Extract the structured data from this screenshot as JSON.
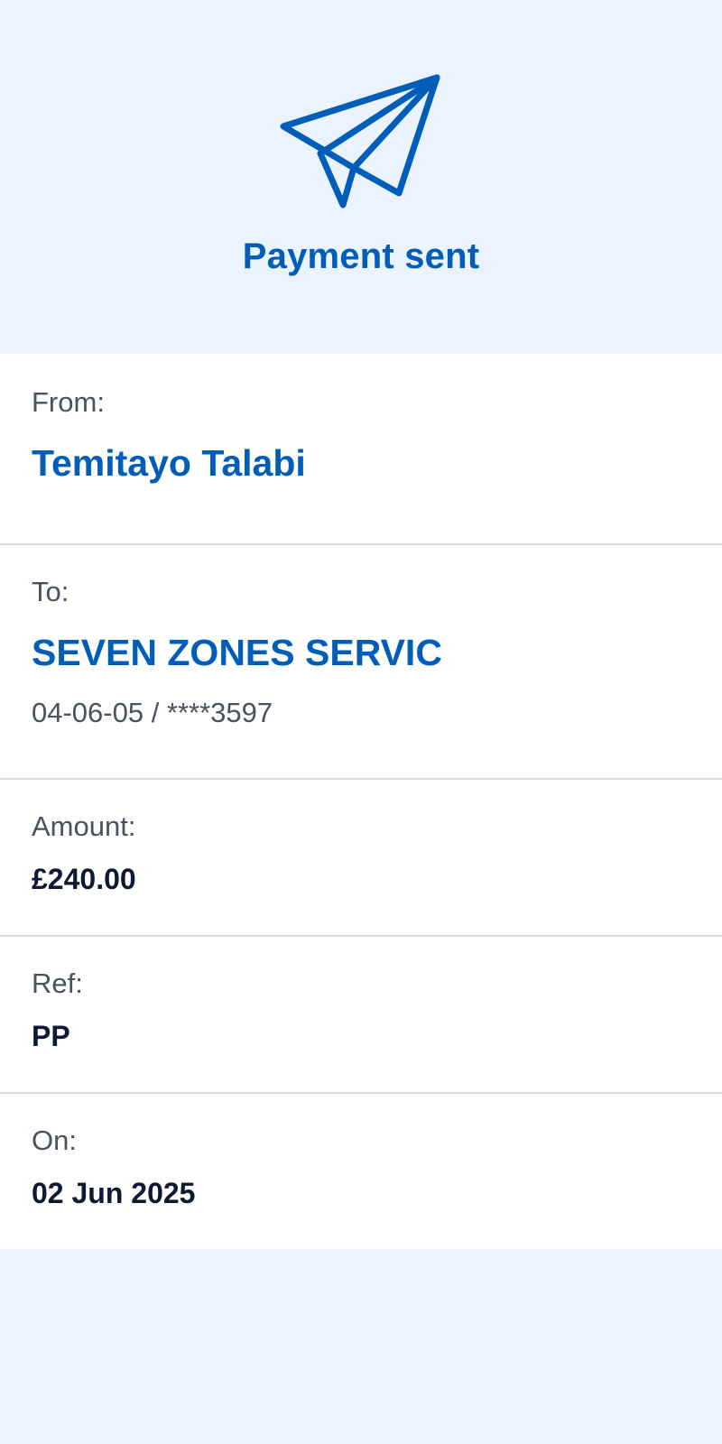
{
  "header": {
    "icon": "paper-plane-icon",
    "title": "Payment sent",
    "accent_color": "#005eb8",
    "background_color": "#eaf3fe"
  },
  "details": {
    "from": {
      "label": "From:",
      "name": "Temitayo Talabi"
    },
    "to": {
      "label": "To:",
      "name": "SEVEN ZONES SERVIC",
      "account": "04-06-05 / ****3597"
    },
    "amount": {
      "label": "Amount:",
      "value": "£240.00"
    },
    "ref": {
      "label": "Ref:",
      "value": "PP"
    },
    "on": {
      "label": "On:",
      "value": "02 Jun 2025"
    }
  }
}
